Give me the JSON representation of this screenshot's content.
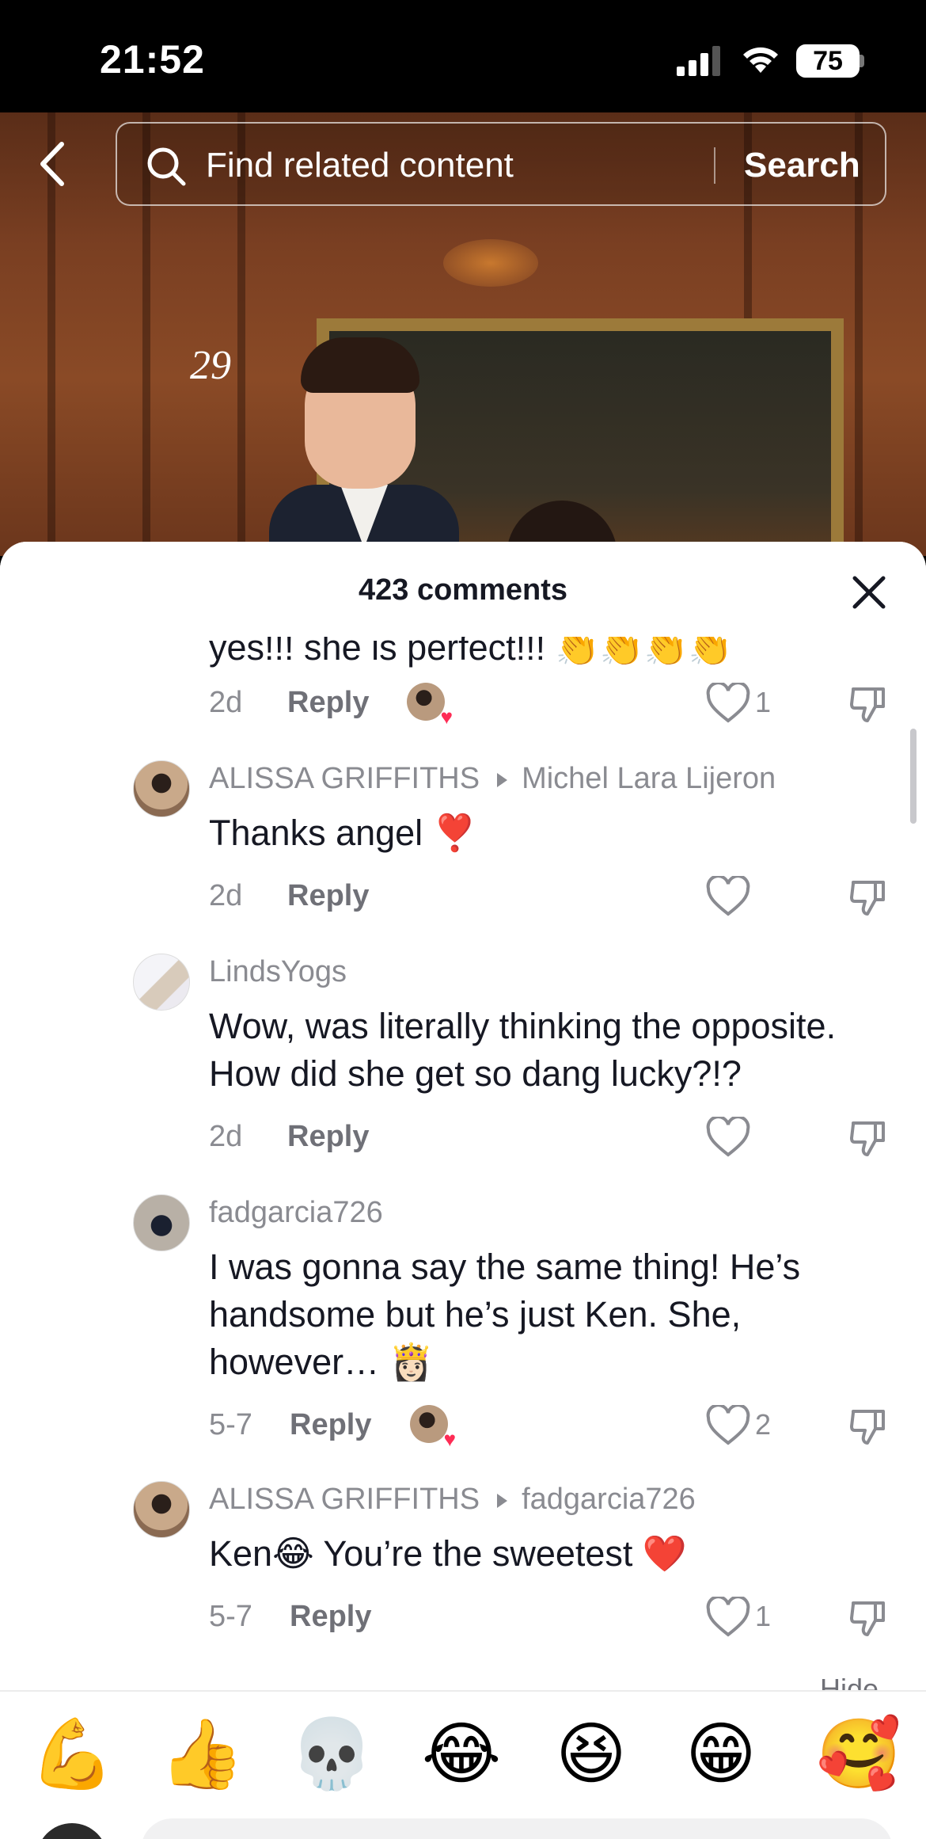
{
  "status_bar": {
    "time": "21:52",
    "battery": "75"
  },
  "video": {
    "overlay_number": "29"
  },
  "search": {
    "placeholder": "Find related content",
    "button_label": "Search"
  },
  "comments_sheet": {
    "count_label": "423 comments",
    "hide_label": "Hide",
    "comments": [
      {
        "text": "yes!!! she is perfect!!! 👏👏👏👏",
        "time": "2d",
        "reply_label": "Reply",
        "likes": "1",
        "creator_liked": true
      },
      {
        "username": "ALISSA GRIFFITHS",
        "reply_to": "Michel Lara Lijeron",
        "text": "Thanks angel ❣️",
        "time": "2d",
        "reply_label": "Reply",
        "likes": ""
      },
      {
        "username": "LindsYogs",
        "text": "Wow, was literally thinking the opposite. How did she get so dang lucky?!?",
        "time": "2d",
        "reply_label": "Reply",
        "likes": ""
      },
      {
        "username": "fadgarcia726",
        "text": "I was gonna say the same thing! He’s handsome but he’s just Ken. She, however… 👸🏻",
        "time": "5-7",
        "reply_label": "Reply",
        "likes": "2",
        "creator_liked": true
      },
      {
        "username": "ALISSA GRIFFITHS",
        "reply_to": "fadgarcia726",
        "text": "Ken😂 You’re the sweetest ❤️",
        "time": "5-7",
        "reply_label": "Reply",
        "likes": "1"
      }
    ]
  },
  "emoji_bar": [
    "💪",
    "👍",
    "💀",
    "😂",
    "😆",
    "😁",
    "🥰"
  ],
  "colors": {
    "accent_heart": "#fe2c55",
    "text_primary": "#161823",
    "text_secondary": "#8a8b91"
  }
}
